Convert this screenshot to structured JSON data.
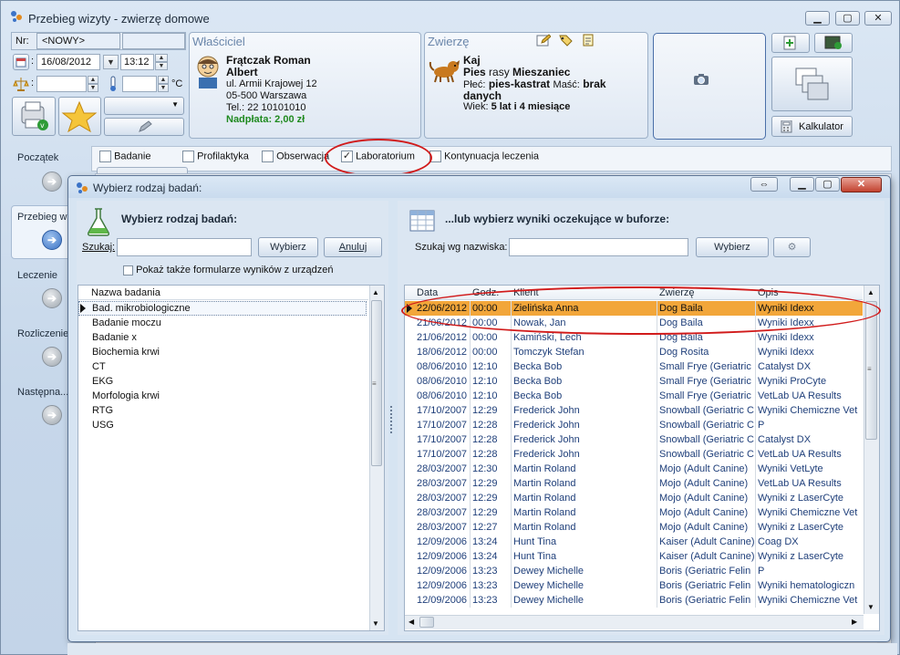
{
  "app": {
    "title": "Przebieg wizyty - zwierzę domowe"
  },
  "visit": {
    "nr_label": "Nr:",
    "nr_value": "<NOWY>",
    "date": "16/08/2012",
    "time": "13:12",
    "temp_unit": "°C"
  },
  "owner": {
    "header": "Właściciel",
    "name_line1": "Frątczak Roman",
    "name_line2": "Albert",
    "street": "ul. Armii Krajowej 12",
    "city": "05-500  Warszawa",
    "phone": "Tel.: 22 10101010",
    "balance": "Nadpłata: 2,00 zł"
  },
  "animal": {
    "header": "Zwierzę",
    "name": "Kaj",
    "species": "Pies",
    "breed_label": "rasy",
    "breed": "Mieszaniec",
    "sex_label": "Płeć:",
    "sex": "pies-kastrat",
    "color_label": "Maść:",
    "color_line1": "brak",
    "color_line2": "danych",
    "age_label": "Wiek:",
    "age": "5 lat i 4 miesiące"
  },
  "toolbar": {
    "calculator": "Kalkulator"
  },
  "nav": {
    "items": [
      {
        "label": "Początek"
      },
      {
        "label": "Przebieg w"
      },
      {
        "label": "Leczenie"
      },
      {
        "label": "Rozliczenie"
      },
      {
        "label": "Następna..."
      }
    ]
  },
  "visit_types": [
    {
      "label": "Badanie",
      "checked": false
    },
    {
      "label": "Profilaktyka",
      "checked": false
    },
    {
      "label": "Obserwacja",
      "checked": false
    },
    {
      "label": "Laboratorium",
      "checked": true
    },
    {
      "label": "Kontynuacja leczenia",
      "checked": false
    }
  ],
  "dialog": {
    "title": "Wybierz rodzaj badań:",
    "left": {
      "heading": "Wybierz rodzaj badań:",
      "search_label": "Szukaj:",
      "search_value": "",
      "select_button": "Wybierz",
      "cancel_button": "Anuluj",
      "checkbox_label": "Pokaż także formularze wyników z urządzeń",
      "column": "Nazwa badania",
      "items": [
        "Bad. mikrobiologiczne",
        "Badanie moczu",
        "Badanie x",
        "Biochemia krwi",
        "CT",
        "EKG",
        "Morfologia krwi",
        "RTG",
        "USG"
      ]
    },
    "right": {
      "heading": "...lub wybierz wyniki oczekujące w buforze:",
      "search_label": "Szukaj wg nazwiska:",
      "search_value": "",
      "select_button": "Wybierz",
      "columns": [
        "Data",
        "Godz.",
        "Klient",
        "Zwierzę",
        "Opis"
      ],
      "rows": [
        [
          "22/06/2012",
          "00:00",
          "Zielińska Anna",
          "Dog Baila",
          "Wyniki Idexx"
        ],
        [
          "21/06/2012",
          "00:00",
          "Nowak, Jan",
          "Dog Baila",
          "Wyniki Idexx"
        ],
        [
          "21/06/2012",
          "00:00",
          "Kamiński, Lech",
          "Dog Baila",
          "Wyniki Idexx"
        ],
        [
          "18/06/2012",
          "00:00",
          "Tomczyk Stefan",
          "Dog Rosita",
          "Wyniki Idexx"
        ],
        [
          "08/06/2010",
          "12:10",
          "Becka Bob",
          "Small Frye (Geriatric C",
          "Catalyst DX"
        ],
        [
          "08/06/2010",
          "12:10",
          "Becka Bob",
          "Small Frye (Geriatric C",
          "Wyniki ProCyte"
        ],
        [
          "08/06/2010",
          "12:10",
          "Becka Bob",
          "Small Frye (Geriatric C",
          "VetLab UA Results"
        ],
        [
          "17/10/2007",
          "12:29",
          "Frederick John",
          "Snowball (Geriatric C",
          "Wyniki Chemiczne Vet"
        ],
        [
          "17/10/2007",
          "12:28",
          "Frederick John",
          "Snowball (Geriatric C",
          "P"
        ],
        [
          "17/10/2007",
          "12:28",
          "Frederick John",
          "Snowball (Geriatric C",
          "Catalyst DX"
        ],
        [
          "17/10/2007",
          "12:28",
          "Frederick John",
          "Snowball (Geriatric C",
          "VetLab UA Results"
        ],
        [
          "28/03/2007",
          "12:30",
          "Martin Roland",
          "Mojo (Adult Canine)",
          "Wyniki VetLyte"
        ],
        [
          "28/03/2007",
          "12:29",
          "Martin Roland",
          "Mojo (Adult Canine)",
          "VetLab UA Results"
        ],
        [
          "28/03/2007",
          "12:29",
          "Martin Roland",
          "Mojo (Adult Canine)",
          "Wyniki z LaserCyte"
        ],
        [
          "28/03/2007",
          "12:29",
          "Martin Roland",
          "Mojo (Adult Canine)",
          "Wyniki Chemiczne Vet"
        ],
        [
          "28/03/2007",
          "12:27",
          "Martin Roland",
          "Mojo (Adult Canine)",
          "Wyniki z LaserCyte"
        ],
        [
          "12/09/2006",
          "13:24",
          "Hunt Tina",
          "Kaiser (Adult Canine)",
          "Coag DX"
        ],
        [
          "12/09/2006",
          "13:24",
          "Hunt Tina",
          "Kaiser (Adult Canine)",
          "Wyniki z LaserCyte"
        ],
        [
          "12/09/2006",
          "13:23",
          "Dewey Michelle",
          "Boris (Geriatric Felin",
          "P"
        ],
        [
          "12/09/2006",
          "13:23",
          "Dewey Michelle",
          "Boris (Geriatric Felin",
          "Wyniki hematologiczn"
        ],
        [
          "12/09/2006",
          "13:23",
          "Dewey Michelle",
          "Boris (Geriatric Felin",
          "Wyniki Chemiczne Vet"
        ]
      ]
    }
  },
  "colors": {
    "selected_row": "#f2a63a",
    "highlight": "#d11b1b",
    "link_blue": "#1f3f7a"
  }
}
